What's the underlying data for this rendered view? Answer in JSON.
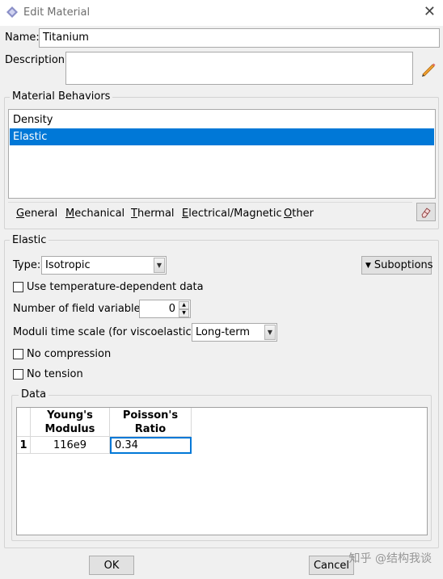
{
  "window": {
    "title": "Edit Material",
    "close_glyph": "✕"
  },
  "name": {
    "label": "Name:",
    "value": "Titanium"
  },
  "description": {
    "label": "Description:",
    "value": ""
  },
  "material_behaviors": {
    "title": "Material Behaviors",
    "items": [
      {
        "label": "Density",
        "selected": false
      },
      {
        "label": "Elastic",
        "selected": true
      }
    ],
    "menu": [
      {
        "label": "General",
        "mnemonic": "G",
        "rest": "eneral"
      },
      {
        "label": "Mechanical",
        "mnemonic": "M",
        "rest": "echanical"
      },
      {
        "label": "Thermal",
        "mnemonic": "T",
        "rest": "hermal"
      },
      {
        "label": "Electrical/Magnetic",
        "mnemonic": "E",
        "rest": "lectrical/Magnetic"
      },
      {
        "label": "Other",
        "mnemonic": "O",
        "rest": "ther"
      }
    ]
  },
  "elastic": {
    "title": "Elastic",
    "type_label": "Type:",
    "type_value": "Isotropic",
    "suboptions_label": "Suboptions",
    "temp_dependent_label": "Use temperature-dependent data",
    "field_vars_label": "Number of field variables:",
    "field_vars_value": "0",
    "moduli_label": "Moduli time scale (for viscoelasticity):",
    "moduli_value": "Long-term",
    "no_compression_label": "No compression",
    "no_tension_label": "No tension",
    "data": {
      "title": "Data",
      "columns": [
        {
          "line1": "Young's",
          "line2": "Modulus"
        },
        {
          "line1": "Poisson's",
          "line2": "Ratio"
        }
      ],
      "rows": [
        {
          "index": "1",
          "values": [
            "116e9",
            "0.34"
          ]
        }
      ]
    }
  },
  "buttons": {
    "ok": "OK",
    "cancel": "Cancel"
  },
  "watermark": "知乎 @结构我谈",
  "colors": {
    "selection": "#0078d7",
    "pencil": "#f0a030"
  }
}
